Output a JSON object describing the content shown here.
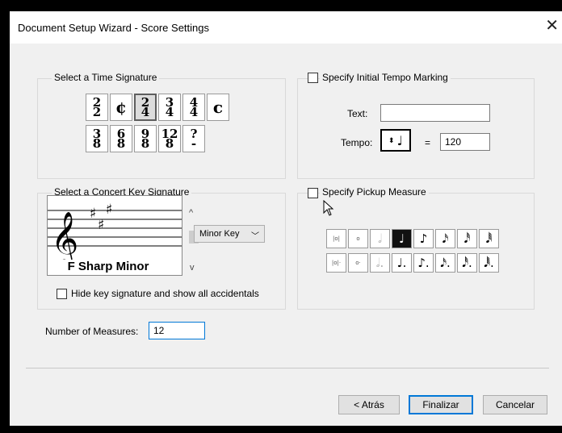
{
  "dialog": {
    "title": "Document Setup Wizard - Score Settings",
    "close": "✕"
  },
  "time_signature": {
    "label": "Select a Time Signature",
    "row1": [
      {
        "top": "2",
        "bottom": "2",
        "name": "ts-2-2"
      },
      {
        "sym": "¢",
        "name": "ts-cut-time"
      },
      {
        "top": "2",
        "bottom": "4",
        "name": "ts-2-4",
        "selected": true
      },
      {
        "top": "3",
        "bottom": "4",
        "name": "ts-3-4"
      },
      {
        "top": "4",
        "bottom": "4",
        "name": "ts-4-4"
      },
      {
        "sym": "c",
        "name": "ts-common-time"
      }
    ],
    "row2": [
      {
        "top": "3",
        "bottom": "8",
        "name": "ts-3-8"
      },
      {
        "top": "6",
        "bottom": "8",
        "name": "ts-6-8"
      },
      {
        "top": "9",
        "bottom": "8",
        "name": "ts-9-8"
      },
      {
        "top": "12",
        "bottom": "8",
        "name": "ts-12-8"
      },
      {
        "top": "?",
        "bottom": "-",
        "name": "ts-other"
      }
    ]
  },
  "key_signature": {
    "label": "Select a Concert Key Signature",
    "key_name": "F Sharp Minor",
    "mode": "Minor Key",
    "hide_label": "Hide key signature and show all accidentals",
    "hide_checked": false,
    "up": "^",
    "down": "v"
  },
  "tempo": {
    "label": "Specify Initial Tempo Marking",
    "checked": false,
    "text_label": "Text:",
    "text_value": "",
    "tempo_label": "Tempo:",
    "equals": "=",
    "value": "120",
    "note": "♩"
  },
  "pickup": {
    "label": "Specify Pickup Measure",
    "checked": false,
    "row1": [
      {
        "g": "|o|",
        "cls": "small",
        "name": "pickup-breve"
      },
      {
        "g": "o",
        "cls": "small",
        "name": "pickup-whole"
      },
      {
        "g": "𝅗𝅥",
        "cls": "gray",
        "name": "pickup-half"
      },
      {
        "g": "♩",
        "cls": "sel",
        "name": "pickup-quarter"
      },
      {
        "g": "♪",
        "cls": "",
        "name": "pickup-eighth"
      },
      {
        "g": "𝅘𝅥𝅯",
        "cls": "",
        "name": "pickup-16th"
      },
      {
        "g": "𝅘𝅥𝅰",
        "cls": "",
        "name": "pickup-32nd"
      },
      {
        "g": "𝅘𝅥𝅱",
        "cls": "",
        "name": "pickup-64th"
      }
    ],
    "row2": [
      {
        "g": "|o|·",
        "cls": "small",
        "name": "pickup-dotted-breve"
      },
      {
        "g": "o·",
        "cls": "small",
        "name": "pickup-dotted-whole"
      },
      {
        "g": "𝅗𝅥.",
        "cls": "gray",
        "name": "pickup-dotted-half"
      },
      {
        "g": "♩.",
        "cls": "",
        "name": "pickup-dotted-quarter"
      },
      {
        "g": "♪.",
        "cls": "",
        "name": "pickup-dotted-eighth"
      },
      {
        "g": "𝅘𝅥𝅯.",
        "cls": "",
        "name": "pickup-dotted-16th"
      },
      {
        "g": "𝅘𝅥𝅰.",
        "cls": "",
        "name": "pickup-dotted-32nd"
      },
      {
        "g": "𝅘𝅥𝅱.",
        "cls": "",
        "name": "pickup-dotted-64th"
      }
    ]
  },
  "measures": {
    "label": "Number of Measures:",
    "value": "12"
  },
  "footer": {
    "back": "< Atrás",
    "finish": "Finalizar",
    "cancel": "Cancelar"
  },
  "colors": {
    "accent": "#0078d7",
    "selected_note": "#111111"
  }
}
